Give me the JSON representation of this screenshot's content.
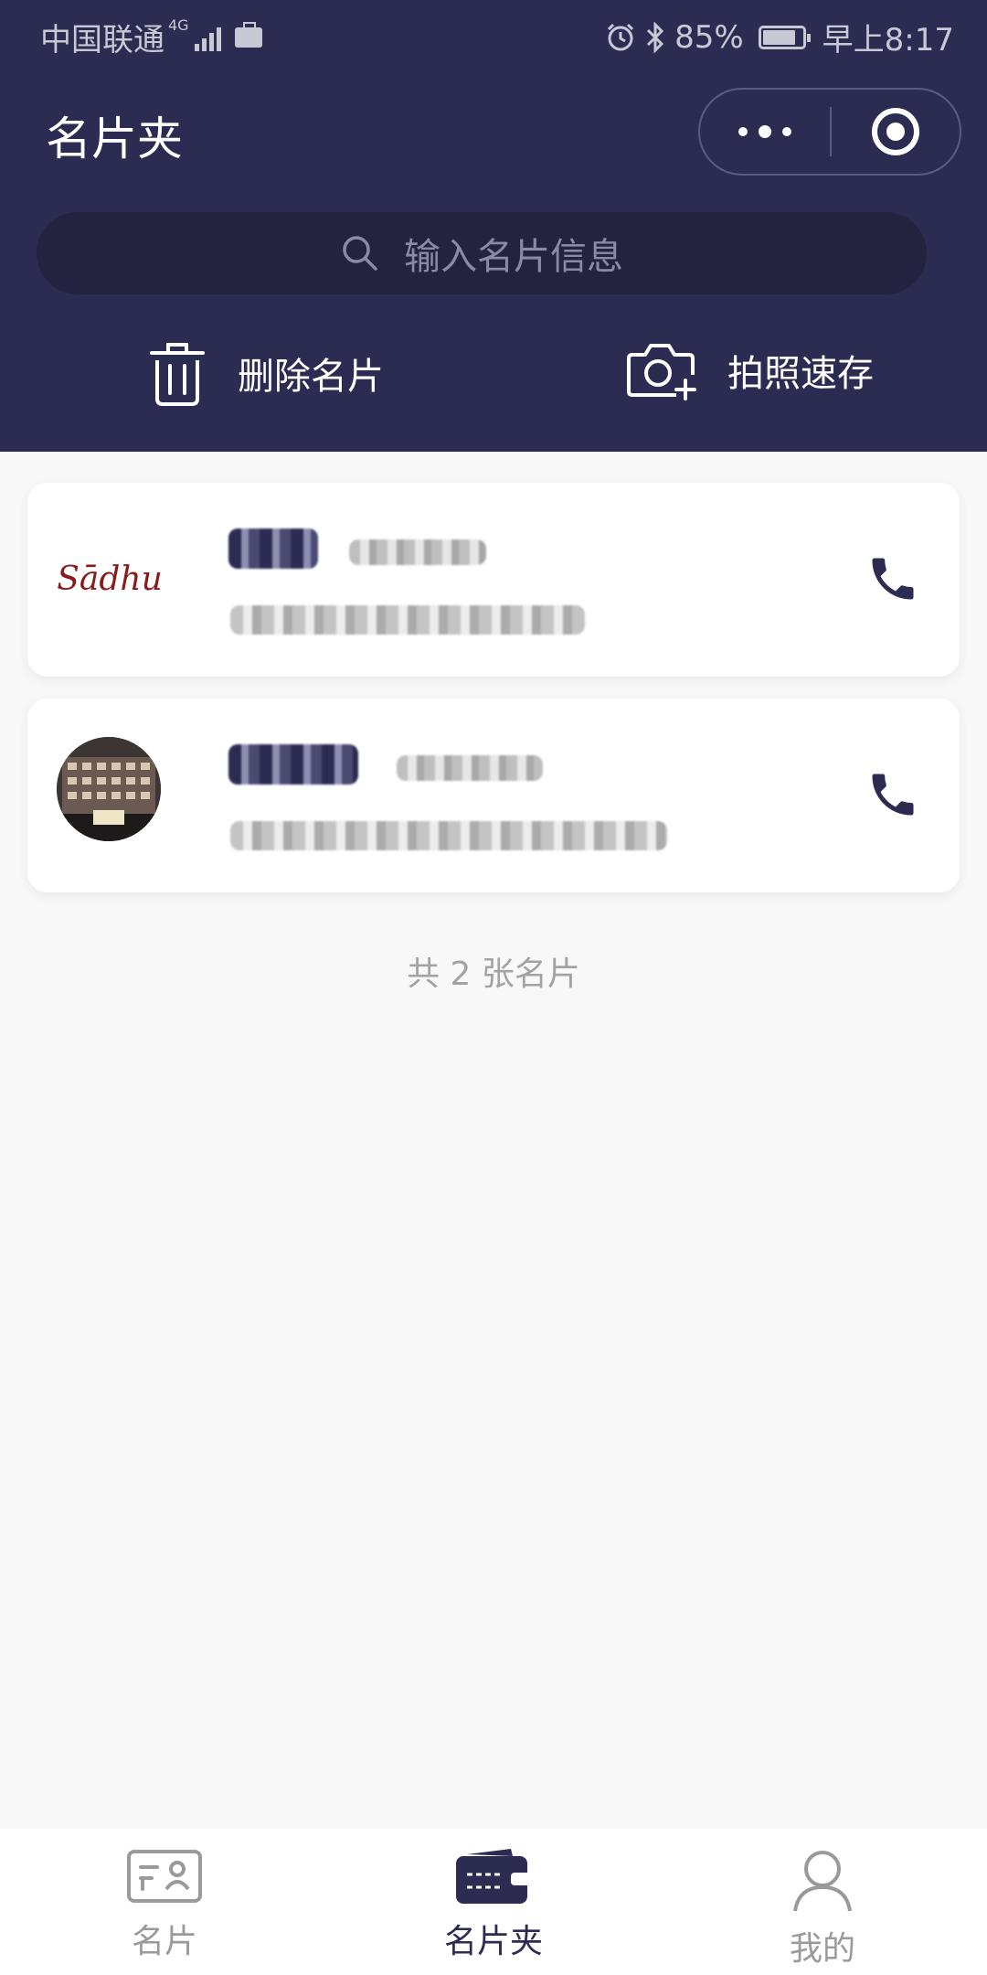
{
  "status_bar": {
    "carrier": "中国联通",
    "network": "4G",
    "battery": "85%",
    "battery_level": 0.85,
    "time": "早上8:17"
  },
  "header": {
    "title": "名片夹"
  },
  "search": {
    "placeholder": "输入名片信息"
  },
  "actions": {
    "delete_label": "删除名片",
    "photo_label": "拍照速存"
  },
  "cards": [
    {
      "logo_text": "Sādhu"
    },
    {}
  ],
  "count_text": "共 2 张名片",
  "tabbar": {
    "items": [
      {
        "label": "名片",
        "icon": "card-icon"
      },
      {
        "label": "名片夹",
        "icon": "wallet-icon"
      },
      {
        "label": "我的",
        "icon": "person-icon"
      }
    ]
  },
  "colors": {
    "brand": "#2c2b52",
    "background": "#f8f8f8"
  }
}
